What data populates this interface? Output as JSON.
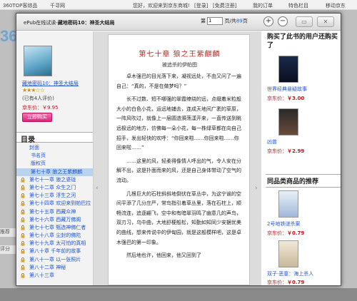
{
  "background": {
    "topbar": {
      "left_link": "360TOP客综品",
      "link2": "千寻网",
      "greeting": "您好，欢迎来到京东商城!",
      "login": "[登录]",
      "register": "[免费注册]",
      "my_orders": "我的订单",
      "features": "特色栏目",
      "mobile": "移动京东"
    },
    "logo": "360",
    "side_labels": [
      "推荐",
      "评分"
    ]
  },
  "reader": {
    "title_prefix": "ePub在线试读-",
    "title_book": "藏地密码10：神圣大结局",
    "pager": {
      "label_page": "第",
      "page_value": "1",
      "label_total": "页/共",
      "total": "89",
      "label_end": "页"
    },
    "zoom_in": "+",
    "zoom_out": "−",
    "win_restore": "▭",
    "win_close": "✕"
  },
  "left_panel": {
    "book_name": "藏地密码10：神圣大结局",
    "stars": "★★★☆☆",
    "reviews": "(已有4人评价)",
    "price_label": "京东价：",
    "price": "￥9.95",
    "buy_button": "立即购买",
    "toc_header": "目录",
    "toc": [
      {
        "label": "封面",
        "style": "sub",
        "locked": false
      },
      {
        "label": "书名页",
        "style": "ch",
        "locked": false
      },
      {
        "label": "版权页",
        "style": "ch",
        "locked": false
      },
      {
        "label": "第七十章  狼之王紫麒麟",
        "style": "ch",
        "locked": false,
        "active": true
      },
      {
        "label": "第七十一章  狼之婆珑",
        "style": "sub",
        "locked": true
      },
      {
        "label": "第七十二章  众生之门",
        "style": "sub",
        "locked": true
      },
      {
        "label": "第七十三章  浮生之河",
        "style": "sub",
        "locked": true
      },
      {
        "label": "第七十四章  欢迎来到帕巴拉",
        "style": "sub",
        "locked": true
      },
      {
        "label": "第七十五章  西藏众神",
        "style": "sub",
        "locked": true
      },
      {
        "label": "第七十六章  西藏万佛阁",
        "style": "sub",
        "locked": true
      },
      {
        "label": "第七十七章  甄选神佛仁者",
        "style": "sub",
        "locked": true
      },
      {
        "label": "第七十八章  尘封的佛陀",
        "style": "sub",
        "locked": true
      },
      {
        "label": "第七十九章  太可怕的真相",
        "style": "sub",
        "locked": true
      },
      {
        "label": "第八十章  千年前的故事",
        "style": "sub",
        "locked": true
      },
      {
        "label": "第八十一章  以一张照片",
        "style": "sub",
        "locked": true
      },
      {
        "label": "第八十二章  神秘",
        "style": "sub",
        "locked": true
      },
      {
        "label": "第八十三章",
        "style": "sub",
        "locked": true
      }
    ]
  },
  "page": {
    "prev_arrow": "‹",
    "next_arrow": "›",
    "chapter_title": "第七十章  狼之王紫麒麟",
    "author_line": "被追杀的伊帕图",
    "paragraphs": [
      "卓木强巴的目光落下来，凝视远处，不由又问了一遍自己：“真的，不是在做梦吗？”",
      "长不过数、短不哪强的翠霞缭绕的远，点缀着米粒般大小的白色小花，运远地铺去，连成天地间广袤的草原，一阵风吹过，就像上一层圆涟漪荡漾开来，一直传送到眺远极远的地方，仿佛每一朵小花，每一株绿草都在向自己招手，发出轻快的欢呼：“你回来啦……你回来啦……你回来啦……”",
      "……这里的风，轻柔得像情人呼出的气，令人安在分解不出，这是扑面而来的风，还是自己身体带动了空气的流动。",
      "几根巨大的石柱斜斜地倒伏在草丛中，为这宁谧的空间平添了几分庄严，常鸟指引着草丛里，落在石柱上，顺畅流连，追逐翩飞，空中和有暗翠羽鸣了幽意几的声鸟，双刃习，乌中曲，大地舒梗般松，知勤如知同少安据优美的曲线，想来传说中的伊甸园，就是这般模样吧，这是卓木强巴的第一印象。",
      "然后地也许，他回来，他又回到了"
    ]
  },
  "right_panel": {
    "also_bought_header": "购买了此书的用户还购买了",
    "also_bought": [
      {
        "title": "世界经典悬疑故事",
        "price_label": "京东价：",
        "price": "￥3.00"
      },
      {
        "title": "凶兽",
        "price_label": "京东价：",
        "price": "￥2.99"
      }
    ],
    "same_class_header": "同品类商品的推荐",
    "same_class": [
      {
        "title": "2号地铁谜杀案",
        "price_label": "京东价：",
        "price": "￥0.79"
      },
      {
        "title": "双子·恶童：海上杀人",
        "price_label": "京东价：",
        "price": "￥0.79"
      }
    ]
  }
}
